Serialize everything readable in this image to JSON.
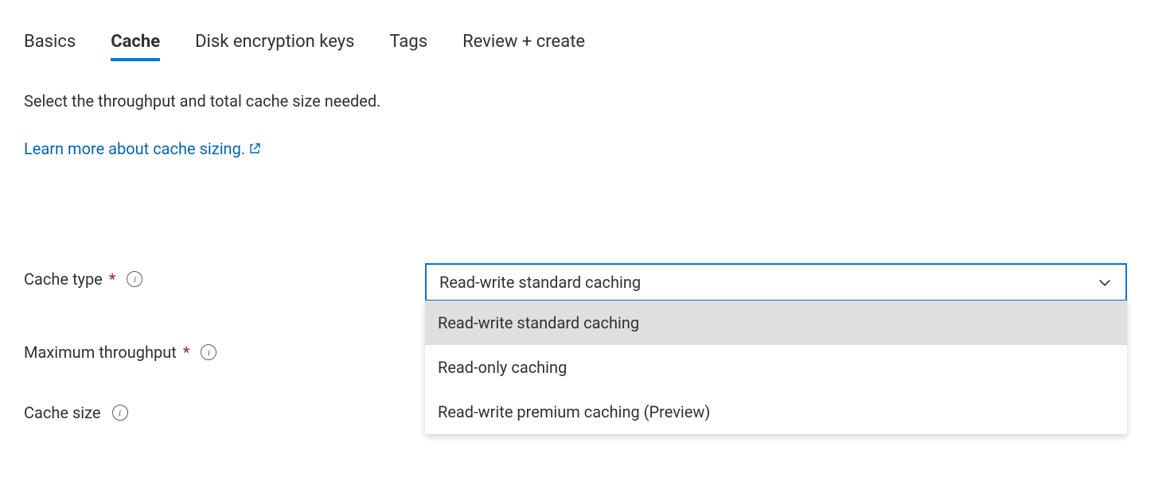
{
  "tabs": {
    "basics": "Basics",
    "cache": "Cache",
    "disk_encryption": "Disk encryption keys",
    "tags": "Tags",
    "review": "Review + create"
  },
  "description": "Select the throughput and total cache size needed.",
  "learn_more": "Learn more about cache sizing.",
  "fields": {
    "cache_type": {
      "label": "Cache type",
      "required": true,
      "value": "Read-write standard caching",
      "options": [
        "Read-write standard caching",
        "Read-only caching",
        "Read-write premium caching (Preview)"
      ]
    },
    "max_throughput": {
      "label": "Maximum throughput",
      "required": true
    },
    "cache_size": {
      "label": "Cache size",
      "required": false
    }
  }
}
